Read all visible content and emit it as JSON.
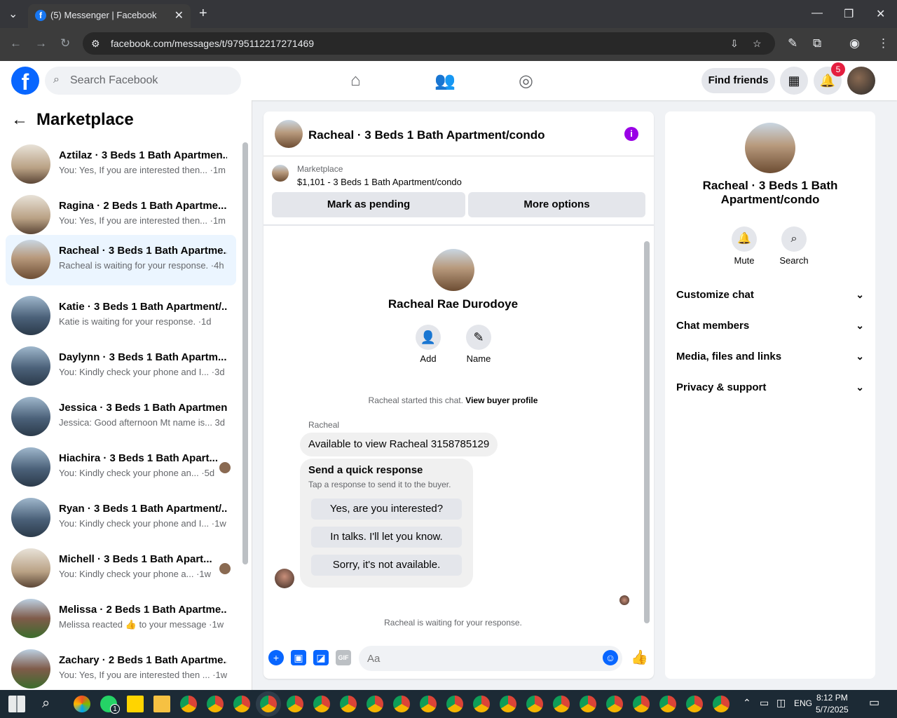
{
  "browser": {
    "tab_title": "(5) Messenger | Facebook",
    "url": "facebook.com/messages/t/9795112217271469"
  },
  "header": {
    "search_placeholder": "Search Facebook",
    "find_friends": "Find friends",
    "notification_count": "5"
  },
  "sidebar": {
    "title": "Marketplace",
    "conversations": [
      {
        "name": "Aztilaz · 3 Beds 1 Bath Apartmen...",
        "preview": "You: Yes, If you are interested then... ·1m"
      },
      {
        "name": "Ragina · 2 Beds 1 Bath Apartme...",
        "preview": "You: Yes, If you are interested then... ·1m"
      },
      {
        "name": "Racheal · 3 Beds 1 Bath Apartme...",
        "preview": "Racheal is waiting for your response. ·4h"
      },
      {
        "name": "Katie · 3 Beds 1 Bath Apartment/...",
        "preview": "Katie is waiting for your response. ·1d"
      },
      {
        "name": "Daylynn · 3 Beds 1 Bath Apartm...",
        "preview": "You: Kindly check your phone and I... ·3d"
      },
      {
        "name": "Jessica · 3 Beds 1 Bath Apartmen...",
        "preview": "Jessica: Good afternoon Mt name is... 3d"
      },
      {
        "name": "Hiachira · 3 Beds 1 Bath Apart...",
        "preview": "You: Kindly check your phone an... ·5d"
      },
      {
        "name": "Ryan · 3 Beds 1 Bath Apartment/...",
        "preview": "You: Kindly check your phone and I... ·1w"
      },
      {
        "name": "Michell · 3 Beds 1 Bath Apart...",
        "preview": "You: Kindly check your phone a... ·1w"
      },
      {
        "name": "Melissa · 2 Beds 1 Bath Apartme...",
        "preview": "Melissa reacted 👍 to your message ·1w"
      },
      {
        "name": "Zachary · 2 Beds 1 Bath Apartme...",
        "preview": "You: Yes, If you are interested then ... ·1w"
      }
    ]
  },
  "chat": {
    "title": "Racheal · 3 Beds 1 Bath Apartment/condo",
    "marketplace_label": "Marketplace",
    "listing": "$1,101 - 3 Beds 1 Bath Apartment/condo",
    "mark_pending": "Mark as pending",
    "more_options": "More options",
    "contact_name": "Racheal Rae Durodoye",
    "add_label": "Add",
    "name_label": "Name",
    "started_text": "Racheal started this chat.",
    "view_profile": "View buyer profile",
    "sender": "Racheal",
    "message": "Available to view Racheal 3158785129",
    "quick_title": "Send a quick response",
    "quick_sub": "Tap a response to send it to the buyer.",
    "quick_replies": [
      "Yes, are you interested?",
      "In talks. I'll let you know.",
      "Sorry, it's not available."
    ],
    "waiting": "Racheal is waiting for your response.",
    "composer_placeholder": "Aa",
    "gif": "GIF"
  },
  "details": {
    "name": "Racheal · 3 Beds 1 Bath Apartment/condo",
    "mute": "Mute",
    "search": "Search",
    "sections": [
      "Customize chat",
      "Chat members",
      "Media, files and links",
      "Privacy & support"
    ]
  },
  "taskbar": {
    "time": "8:12 PM",
    "date": "5/7/2025",
    "lang": "ENG",
    "whatsapp_badge": "1"
  }
}
